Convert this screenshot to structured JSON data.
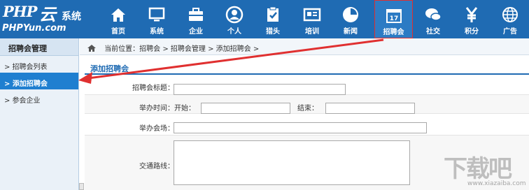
{
  "logo": {
    "php": "PHP",
    "yun": "云",
    "system": "系统",
    "url": "PHPYun.com"
  },
  "nav": [
    {
      "label": "首页",
      "icon": "home-icon"
    },
    {
      "label": "系统",
      "icon": "monitor-icon"
    },
    {
      "label": "企业",
      "icon": "briefcase-icon"
    },
    {
      "label": "个人",
      "icon": "person-icon"
    },
    {
      "label": "猎头",
      "icon": "clipboard-icon"
    },
    {
      "label": "培训",
      "icon": "board-icon"
    },
    {
      "label": "新闻",
      "icon": "news-icon"
    },
    {
      "label": "招聘会",
      "icon": "calendar-icon",
      "calendar_number": "17",
      "active": true
    },
    {
      "label": "社交",
      "icon": "chat-icon"
    },
    {
      "label": "积分",
      "icon": "yuan-icon"
    },
    {
      "label": "广告",
      "icon": "globe-icon"
    }
  ],
  "sidebar": {
    "title": "招聘会管理",
    "items": [
      {
        "label": "> 招聘会列表"
      },
      {
        "label": "> 添加招聘会",
        "active": true
      },
      {
        "label": "> 参会企业"
      }
    ]
  },
  "breadcrumb": {
    "text": "当前位置：招聘会  >  招聘会管理  >  添加招聘会  >"
  },
  "form": {
    "section_title": "添加招聘会",
    "title_label": "招聘会标题：",
    "title_value": "",
    "time_label": "举办时间：",
    "start_label": "开始：",
    "start_value": "",
    "end_label": "结束：",
    "end_value": "",
    "venue_label": "举办会场：",
    "venue_value": "",
    "route_label": "交通路线：",
    "route_value": ""
  },
  "watermark": {
    "text": "下载吧",
    "url": "www.xiazaiba.com"
  },
  "colors": {
    "header_bg": "#1f6bb3",
    "accent": "#1f7fd0",
    "annotation_red": "#e03030"
  }
}
